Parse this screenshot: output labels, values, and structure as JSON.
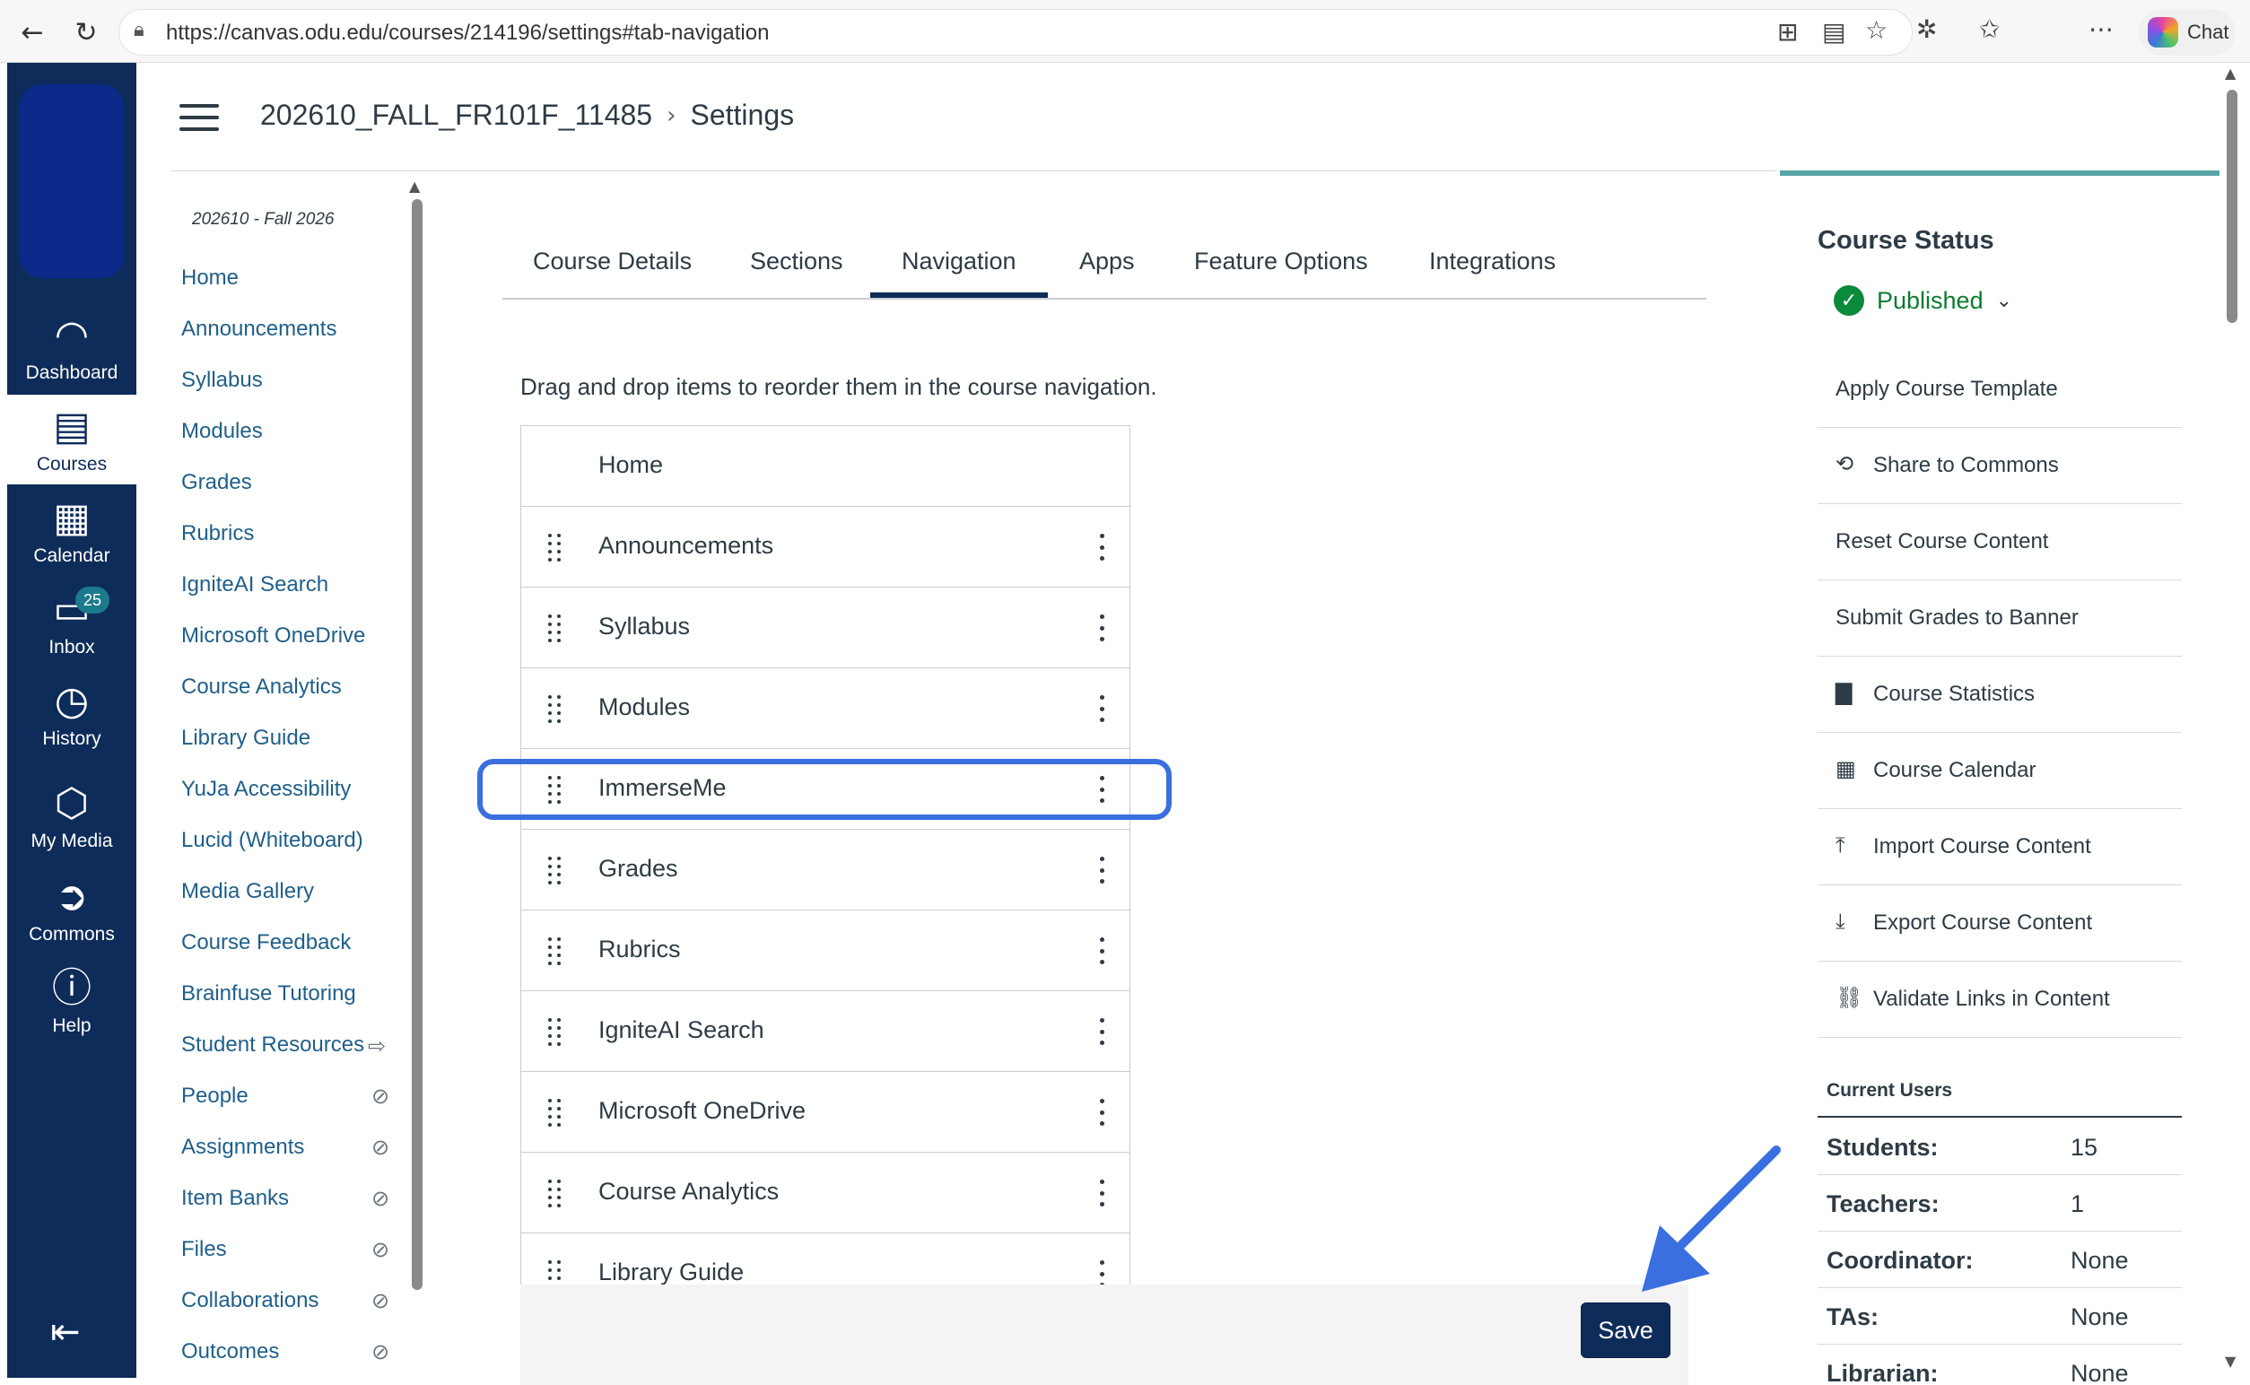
{
  "browser": {
    "url": "https://canvas.odu.edu/courses/214196/settings#tab-navigation",
    "chat_label": "Chat"
  },
  "global_nav": {
    "items": [
      {
        "label": "Dashboard",
        "icon": "dashboard-icon"
      },
      {
        "label": "Courses",
        "icon": "courses-icon"
      },
      {
        "label": "Calendar",
        "icon": "calendar-icon"
      },
      {
        "label": "Inbox",
        "icon": "inbox-icon",
        "badge": "25"
      },
      {
        "label": "History",
        "icon": "history-icon"
      },
      {
        "label": "My Media",
        "icon": "media-icon"
      },
      {
        "label": "Commons",
        "icon": "commons-icon"
      },
      {
        "label": "Help",
        "icon": "help-icon"
      }
    ]
  },
  "breadcrumb": {
    "course": "202610_FALL_FR101F_11485",
    "page": "Settings"
  },
  "course_nav": {
    "term": "202610 - Fall 2026",
    "items": [
      {
        "label": "Home"
      },
      {
        "label": "Announcements"
      },
      {
        "label": "Syllabus"
      },
      {
        "label": "Modules"
      },
      {
        "label": "Grades"
      },
      {
        "label": "Rubrics"
      },
      {
        "label": "IgniteAI Search"
      },
      {
        "label": "Microsoft OneDrive"
      },
      {
        "label": "Course Analytics"
      },
      {
        "label": "Library Guide"
      },
      {
        "label": "YuJa Accessibility"
      },
      {
        "label": "Lucid (Whiteboard)"
      },
      {
        "label": "Media Gallery"
      },
      {
        "label": "Course Feedback"
      },
      {
        "label": "Brainfuse Tutoring"
      },
      {
        "label": "Student Resources",
        "external": true
      },
      {
        "label": "People",
        "hidden": true
      },
      {
        "label": "Assignments",
        "hidden": true
      },
      {
        "label": "Item Banks",
        "hidden": true
      },
      {
        "label": "Files",
        "hidden": true
      },
      {
        "label": "Collaborations",
        "hidden": true
      },
      {
        "label": "Outcomes",
        "hidden": true
      }
    ]
  },
  "tabs": [
    {
      "label": "Course Details"
    },
    {
      "label": "Sections"
    },
    {
      "label": "Navigation",
      "active": true
    },
    {
      "label": "Apps"
    },
    {
      "label": "Feature Options"
    },
    {
      "label": "Integrations"
    }
  ],
  "instructions": "Drag and drop items to reorder them in the course navigation.",
  "nav_list": [
    {
      "label": "Home",
      "fixed": true
    },
    {
      "label": "Announcements"
    },
    {
      "label": "Syllabus"
    },
    {
      "label": "Modules"
    },
    {
      "label": "ImmerseMe",
      "highlighted": true
    },
    {
      "label": "Grades"
    },
    {
      "label": "Rubrics"
    },
    {
      "label": "IgniteAI Search"
    },
    {
      "label": "Microsoft OneDrive"
    },
    {
      "label": "Course Analytics"
    },
    {
      "label": "Library Guide"
    }
  ],
  "save_label": "Save",
  "sidebar": {
    "status_title": "Course Status",
    "status": "Published",
    "actions": [
      {
        "label": "Apply Course Template",
        "icon": ""
      },
      {
        "label": "Share to Commons",
        "icon": "share-icon"
      },
      {
        "label": "Reset Course Content",
        "icon": ""
      },
      {
        "label": "Submit Grades to Banner",
        "icon": ""
      },
      {
        "label": "Course Statistics",
        "icon": "bar-chart-icon"
      },
      {
        "label": "Course Calendar",
        "icon": "calendar-icon"
      },
      {
        "label": "Import Course Content",
        "icon": "upload-icon"
      },
      {
        "label": "Export Course Content",
        "icon": "download-icon"
      },
      {
        "label": "Validate Links in Content",
        "icon": "link-icon"
      }
    ],
    "current_users_title": "Current Users",
    "current_users": [
      {
        "role": "Students:",
        "count": "15"
      },
      {
        "role": "Teachers:",
        "count": "1"
      },
      {
        "role": "Coordinator:",
        "count": "None"
      },
      {
        "role": "TAs:",
        "count": "None"
      },
      {
        "role": "Librarian:",
        "count": "None"
      }
    ]
  },
  "colors": {
    "nav_bg": "#0e2c5a",
    "accent_teal": "#59a5a8",
    "published_green": "#0b8a3c",
    "highlight_blue": "#3b6fe0",
    "link": "#1f5f8b"
  }
}
